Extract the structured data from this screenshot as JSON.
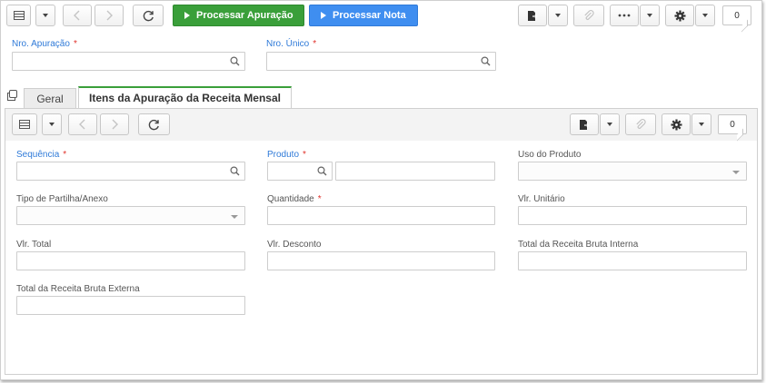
{
  "toolbar": {
    "process_apuracao_label": "Processar Apuração",
    "process_nota_label": "Processar Nota",
    "counter": "0"
  },
  "header": {
    "nro_apuracao_label": "Nro. Apuração",
    "nro_unico_label": "Nro. Único",
    "required_mark": "*"
  },
  "tabs": [
    {
      "label": "Geral"
    },
    {
      "label": "Itens da Apuração da Receita Mensal"
    }
  ],
  "inner_toolbar": {
    "counter": "0"
  },
  "form": {
    "sequencia_label": "Sequência",
    "produto_label": "Produto",
    "uso_produto_label": "Uso do Produto",
    "tipo_partilha_label": "Tipo de Partilha/Anexo",
    "quantidade_label": "Quantidade",
    "vlr_unitario_label": "Vlr. Unitário",
    "vlr_total_label": "Vlr. Total",
    "vlr_desconto_label": "Vlr. Desconto",
    "receita_interna_label": "Total da Receita Bruta Interna",
    "receita_externa_label": "Total da Receita Bruta Externa"
  },
  "colors": {
    "green": "#3a9f3a",
    "blue": "#3f8ef0",
    "required": "#e0322b",
    "label_blue": "#2f7ad8"
  }
}
